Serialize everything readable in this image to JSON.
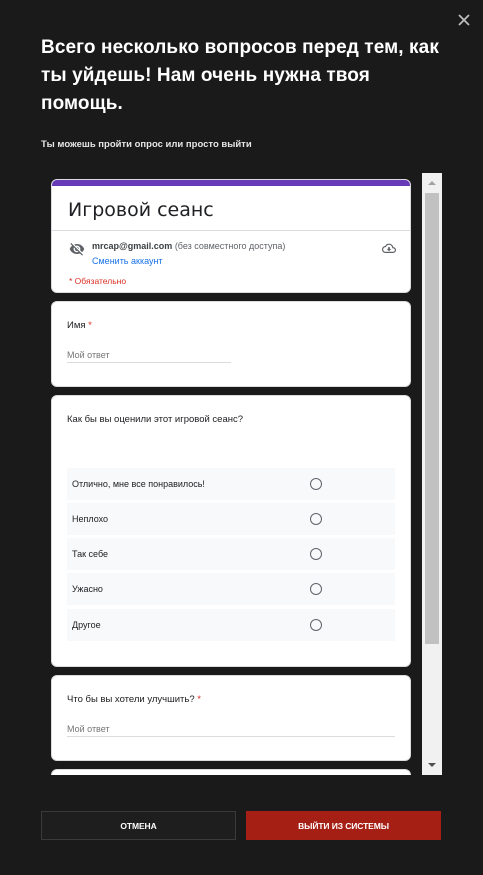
{
  "dialog": {
    "headline": "Всего несколько вопросов перед тем, как ты уйдешь! Нам очень нужна твоя помощь.",
    "subtitle": "Ты можешь пройти опрос или просто выйти",
    "cancel_label": "ОТМЕНА",
    "logout_label": "ВЫЙТИ ИЗ СИСТЕМЫ"
  },
  "form": {
    "title": "Игровой сеанс",
    "account_email": "mrcap@gmail.com",
    "account_sharing": " (без совместного доступа)",
    "switch_account": "Сменить аккаунт",
    "required_note": "* Обязательно",
    "questions": [
      {
        "label": "Имя",
        "required_mark": " *",
        "placeholder": "Мой ответ"
      },
      {
        "label": "Как бы вы оценили этот игровой сеанс?",
        "options": [
          "Отлично, мне все понравилось!",
          "Неплохо",
          "Так себе",
          "Ужасно",
          "Другое"
        ]
      },
      {
        "label": "Что бы вы хотели улучшить?",
        "required_mark": " *",
        "placeholder": "Мой ответ"
      }
    ]
  },
  "colors": {
    "accent_bar": "#673ab7",
    "logout_button": "#a51f15",
    "required": "#d93025",
    "link": "#1a73e8"
  },
  "icons": {
    "close": "close-icon",
    "visibility_off": "eye-off-icon",
    "cloud": "cloud-icon"
  }
}
